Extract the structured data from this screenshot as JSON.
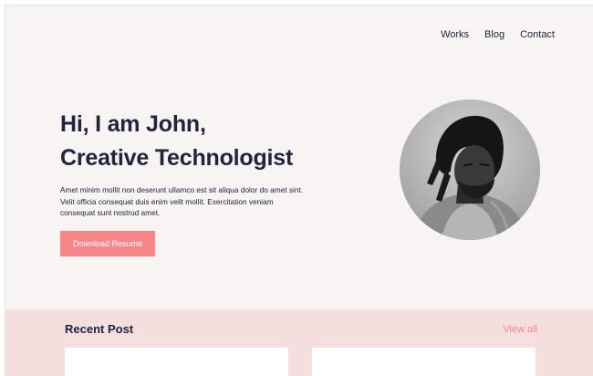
{
  "nav": {
    "items": [
      {
        "label": "Works"
      },
      {
        "label": "Blog"
      },
      {
        "label": "Contact"
      }
    ]
  },
  "hero": {
    "title_line1": "Hi, I am John,",
    "title_line2": "Creative Technologist",
    "description": "Amet minim mollit non deserunt ullamco est sit aliqua dolor do amet sint. Velit officia consequat duis enim velit mollit. Exercitation veniam consequat sunt nostrud amet.",
    "cta_label": "Download Resume",
    "avatar_alt": "Portrait photo"
  },
  "recent": {
    "title": "Recent Post",
    "view_all_label": "View all"
  },
  "colors": {
    "background": "#f8f4f3",
    "accent": "#f7868a",
    "recent_bg": "#f4dede",
    "text": "#21243d"
  }
}
